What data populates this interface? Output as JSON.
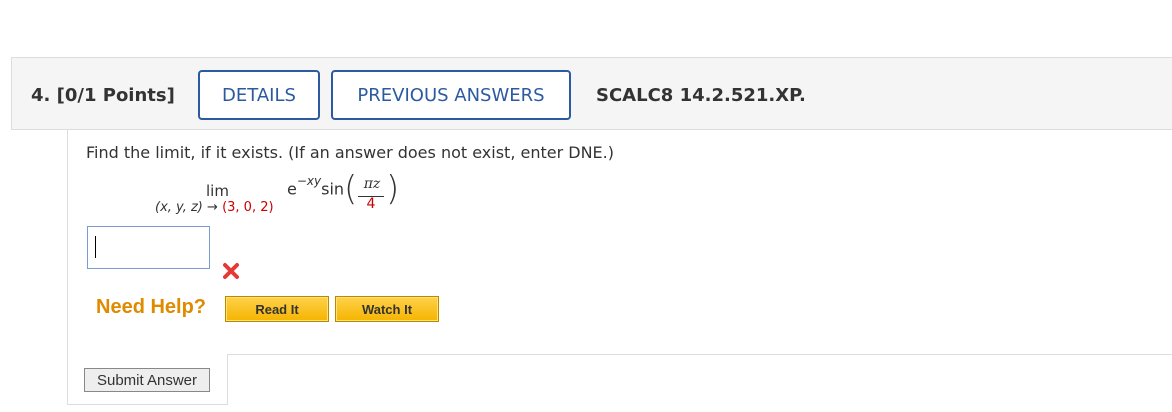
{
  "question": {
    "label": "4.  [0/1 Points]",
    "details_label": "DETAILS",
    "previous_answers_label": "PREVIOUS ANSWERS",
    "course_code": "SCALC8 14.2.521.XP."
  },
  "problem": {
    "instruction": "Find the limit, if it exists. (If an answer does not exist, enter DNE.)",
    "lim": "lim",
    "sub_vars": "(x, y, z)",
    "sub_arrow": "→",
    "sub_point": "(3, 0, 2)",
    "expr_base": "e",
    "expr_exp": "−xy",
    "expr_func": "sin",
    "frac_num": "πz",
    "frac_den": "4"
  },
  "answer": {
    "value": "",
    "status_icon": "incorrect-x-icon",
    "status_color": "#e53935"
  },
  "help": {
    "title": "Need Help?",
    "read_label": "Read It",
    "watch_label": "Watch It"
  },
  "submit_label": "Submit Answer",
  "colors": {
    "accent_blue": "#2b5aa0",
    "help_orange": "#e08a00",
    "red_value": "#cc0000"
  }
}
